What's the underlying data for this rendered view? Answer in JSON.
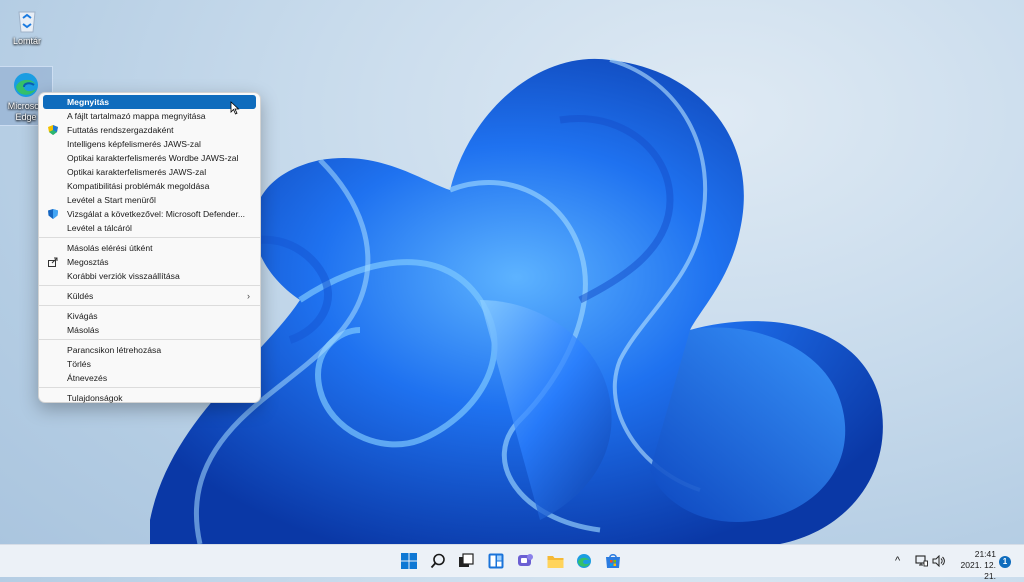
{
  "desktop": {
    "icons": [
      {
        "label": "Lomtár",
        "icon": "recycle-bin-icon"
      },
      {
        "label_line1": "Microsoft",
        "label_line2": "Edge",
        "icon": "edge-icon"
      }
    ]
  },
  "context_menu": {
    "items": [
      {
        "label": "Megnyitás",
        "bold": true,
        "highlighted": true
      },
      {
        "label": "A fájlt tartalmazó mappa megnyitása"
      },
      {
        "label": "Futtatás rendszergazdaként",
        "icon": "shield-uac-icon"
      },
      {
        "label": "Intelligens képfelismerés JAWS-zal"
      },
      {
        "label": "Optikai karakterfelismerés Wordbe JAWS-zal"
      },
      {
        "label": "Optikai karakterfelismerés JAWS-zal"
      },
      {
        "label": "Kompatibilitási problémák megoldása"
      },
      {
        "label": "Levétel a Start menüről"
      },
      {
        "label": "Vizsgálat a következővel: Microsoft Defender...",
        "icon": "defender-icon"
      },
      {
        "label": "Levétel a tálcáról"
      },
      {
        "label": "Másolás elérési útként"
      },
      {
        "label": "Megosztás",
        "icon": "share-icon"
      },
      {
        "label": "Korábbi verziók visszaállítása"
      },
      {
        "label": "Küldés",
        "submenu": true
      },
      {
        "label": "Kivágás"
      },
      {
        "label": "Másolás"
      },
      {
        "label": "Parancsikon létrehozása"
      },
      {
        "label": "Törlés"
      },
      {
        "label": "Átnevezés"
      },
      {
        "label": "Tulajdonságok"
      }
    ]
  },
  "taskbar": {
    "apps": [
      "start-icon",
      "search-icon",
      "task-view-icon",
      "widgets-icon",
      "chat-icon",
      "file-explorer-icon",
      "edge-icon",
      "store-icon"
    ],
    "tray": {
      "chevron": "^",
      "clock_time": "21:41",
      "clock_date": "2021. 12. 21.",
      "notification_count": "1"
    }
  },
  "colors": {
    "accent": "#0f6cbd",
    "bloom_dark": "#0a3fa8",
    "bloom_light": "#2f8cff"
  }
}
